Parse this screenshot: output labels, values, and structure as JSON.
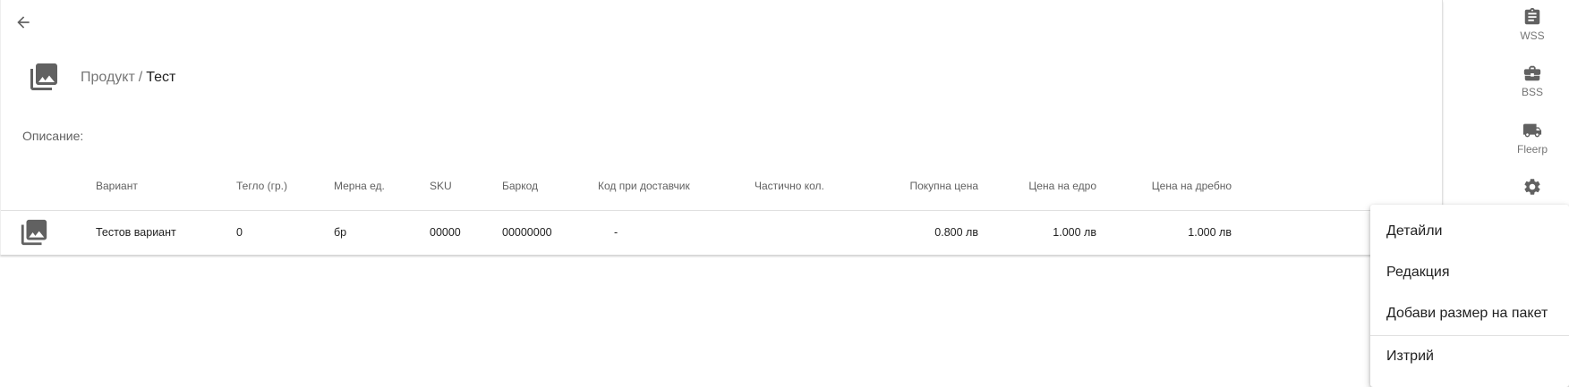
{
  "breadcrumb": {
    "parent": "Продукт",
    "separator": "/",
    "current": "Тест"
  },
  "description_label": "Описание:",
  "table": {
    "headers": {
      "variant": "Вариант",
      "weight": "Тегло (гр.)",
      "unit": "Мерна ед.",
      "sku": "SKU",
      "barcode": "Баркод",
      "supplier_code": "Код при доставчик",
      "partial_qty": "Частично кол.",
      "purchase_price": "Покупна цена",
      "wholesale_price": "Цена на едро",
      "retail_price": "Цена на дребно"
    },
    "rows": [
      {
        "variant": "Тестов вариант",
        "weight": "0",
        "unit": "бр",
        "sku": "00000",
        "barcode": "00000000",
        "supplier_code": "-",
        "partial_qty": "",
        "purchase_price": "0.800 лв",
        "wholesale_price": "1.000 лв",
        "retail_price": "1.000 лв"
      }
    ]
  },
  "rail": {
    "items": [
      {
        "label": "WSS",
        "icon": "clipboard-icon"
      },
      {
        "label": "BSS",
        "icon": "briefcase-icon"
      },
      {
        "label": "Fleerp",
        "icon": "truck-icon"
      },
      {
        "label": "",
        "icon": "gear-icon"
      }
    ]
  },
  "menu": {
    "items": [
      {
        "label": "Детайли"
      },
      {
        "label": "Редакция"
      },
      {
        "label": "Добави размер на пакет"
      },
      {
        "label": "Изтрий"
      }
    ]
  },
  "colors": {
    "icon": "#616161",
    "text_primary": "#212121",
    "text_secondary": "#757575"
  }
}
